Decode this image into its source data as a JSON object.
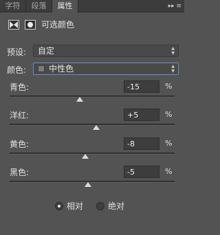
{
  "tabs": [
    {
      "label": "字符",
      "active": false
    },
    {
      "label": "段落",
      "active": false
    },
    {
      "label": "属性",
      "active": true
    }
  ],
  "panel_menu_glyph": "▸▸ ≡",
  "header": {
    "title": "可选颜色",
    "adjustment_icon": "selective-color-icon",
    "mask_icon": "layer-mask-icon"
  },
  "preset": {
    "label": "预设:",
    "value": "自定"
  },
  "colors": {
    "label": "颜色:",
    "value": "中性色",
    "swatch_color": "#7b7b7b"
  },
  "sliders": [
    {
      "label": "青色:",
      "value": "-15",
      "unit": "%",
      "level": -15
    },
    {
      "label": "洋红:",
      "value": "+5",
      "unit": "%",
      "level": 5
    },
    {
      "label": "黄色:",
      "value": "-8",
      "unit": "%",
      "level": -8
    },
    {
      "label": "黑色:",
      "value": "-5",
      "unit": "%",
      "level": -5
    }
  ],
  "method": {
    "options": [
      {
        "label": "相对",
        "selected": true
      },
      {
        "label": "绝对",
        "selected": false
      }
    ]
  },
  "colors_theme": {
    "panel_bg": "#535353",
    "tab_bg": "#3c3c3c",
    "focus_border": "#6b8fc7"
  }
}
